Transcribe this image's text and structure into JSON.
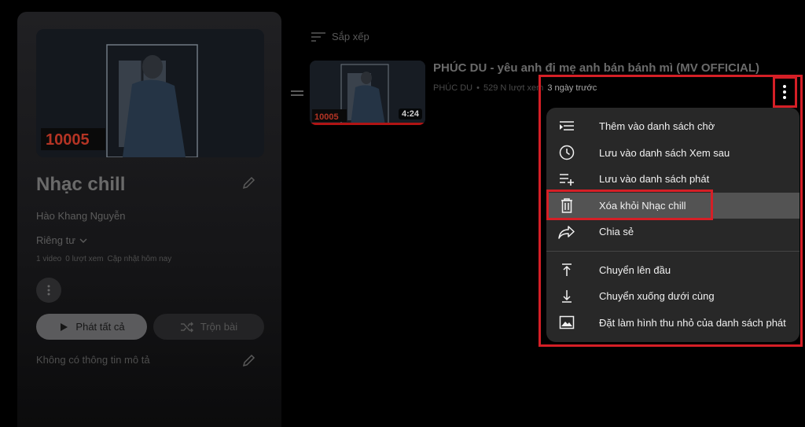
{
  "playlist": {
    "title": "Nhạc chill",
    "author": "Hào Khang Nguyễn",
    "privacy": "Riêng tư",
    "video_count": "1 video",
    "views": "0 lượt xem",
    "updated": "Cập nhật hôm nay",
    "play_all_label": "Phát tất cả",
    "shuffle_label": "Trộn bài",
    "description": "Không có thông tin mô tả",
    "thumb_logo_text": "10005"
  },
  "sort": {
    "label": "Sắp xếp"
  },
  "video": {
    "title": "PHÚC DU - yêu anh đi mẹ anh bán bánh mì (MV OFFICIAL)",
    "channel": "PHÚC DU",
    "separator": "•",
    "views": "529 N lượt xem",
    "time": "3 ngày trước",
    "duration": "4:24",
    "thumb_logo_text": "10005",
    "watch_progress": 1.0
  },
  "menu": {
    "items": [
      {
        "label": "Thêm vào danh sách chờ",
        "icon": "queue-icon"
      },
      {
        "label": "Lưu vào danh sách Xem sau",
        "icon": "clock-icon"
      },
      {
        "label": "Lưu vào danh sách phát",
        "icon": "playlist-add-icon"
      },
      {
        "label": "Xóa khỏi Nhạc chill",
        "icon": "trash-icon",
        "highlighted": true
      },
      {
        "label": "Chia sẻ",
        "icon": "share-icon"
      },
      {
        "label": "Chuyển lên đầu",
        "icon": "move-top-icon"
      },
      {
        "label": "Chuyển xuống dưới cùng",
        "icon": "move-bottom-icon"
      },
      {
        "label": "Đặt làm hình thu nhỏ của danh sách phát",
        "icon": "image-icon"
      }
    ]
  },
  "colors": {
    "highlight": "#d51f26",
    "menu_bg": "#282828",
    "menu_active": "#535353",
    "progress": "#b01414"
  }
}
